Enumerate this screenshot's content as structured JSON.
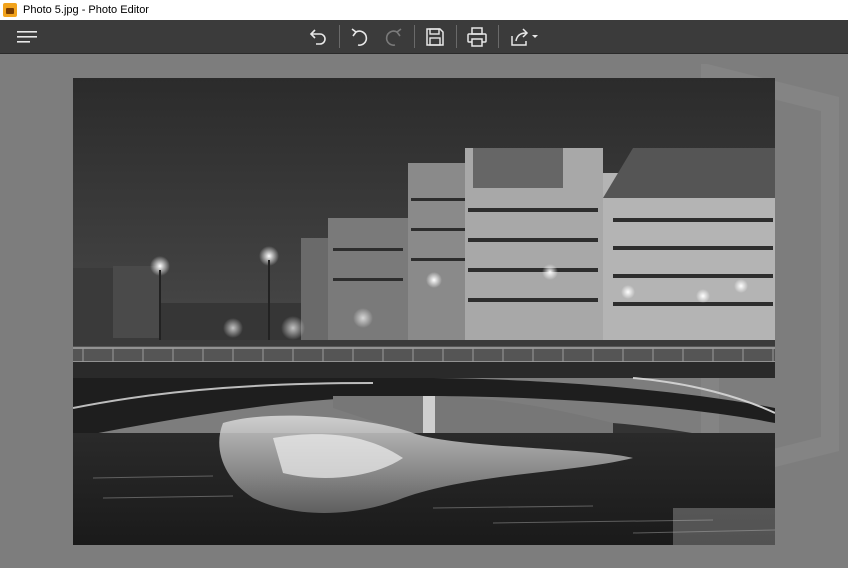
{
  "window": {
    "title": "Photo 5.jpg - Photo Editor"
  },
  "toolbar": {
    "menu_icon": "hamburger-menu-icon",
    "buttons": [
      {
        "name": "undo-icon"
      },
      {
        "name": "rotate-left-icon"
      },
      {
        "name": "rotate-right-icon"
      },
      {
        "name": "save-icon"
      },
      {
        "name": "print-icon"
      },
      {
        "name": "share-icon"
      }
    ]
  },
  "photo": {
    "file": "Photo 5.jpg",
    "style": "black-and-white"
  },
  "colors": {
    "toolbar_bg": "#3b3b3b",
    "canvas_bg": "#7d7d7d",
    "icon": "#e8e8e8",
    "icon_disabled": "#7a7a7a",
    "app_icon": "#f2a31b"
  }
}
